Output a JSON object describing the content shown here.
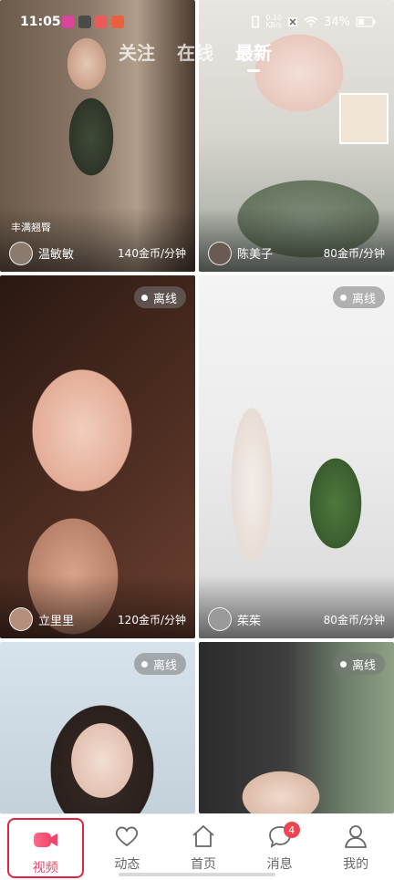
{
  "status_bar": {
    "time": "11:05",
    "net_speed_top": "0.10",
    "net_speed_bottom": "KB/s",
    "battery": "34%"
  },
  "top_tabs": [
    {
      "label": "关注",
      "active": false
    },
    {
      "label": "在线",
      "active": false
    },
    {
      "label": "最新",
      "active": true
    }
  ],
  "cards": [
    {
      "tag": "丰满翘臀",
      "name": "温敏敏",
      "price": "140金币/分钟",
      "status": ""
    },
    {
      "tag": "",
      "name": "陈美子",
      "price": "80金币/分钟",
      "status": ""
    },
    {
      "tag": "",
      "name": "立里里",
      "price": "120金币/分钟",
      "status": "离线"
    },
    {
      "tag": "",
      "name": "茱茱",
      "price": "80金币/分钟",
      "status": "离线"
    },
    {
      "tag": "",
      "name": "",
      "price": "",
      "status": "离线"
    },
    {
      "tag": "",
      "name": "",
      "price": "",
      "status": "离线"
    }
  ],
  "bottom_nav": [
    {
      "label": "视频",
      "icon": "video-camera-icon",
      "active": true
    },
    {
      "label": "动态",
      "icon": "heart-icon",
      "active": false
    },
    {
      "label": "首页",
      "icon": "home-icon",
      "active": false
    },
    {
      "label": "消息",
      "icon": "message-bubble-icon",
      "active": false,
      "badge": "4"
    },
    {
      "label": "我的",
      "icon": "person-icon",
      "active": false
    }
  ],
  "colors": {
    "accent": "#f0456a",
    "badge": "#f04452",
    "active_outline": "#e2233f"
  }
}
